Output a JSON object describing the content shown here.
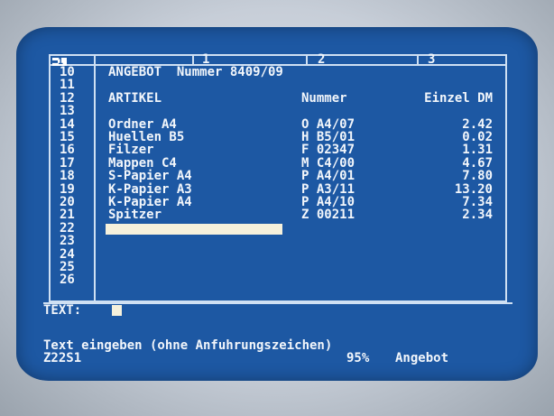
{
  "sheet": {
    "cell_ref_marker": "▬1",
    "columns": [
      "1",
      "2",
      "3"
    ],
    "rows": [
      {
        "num": "10",
        "text": "ANGEBOT  Nummer 8409/09",
        "code": "",
        "price": ""
      },
      {
        "num": "11",
        "text": "",
        "code": "",
        "price": ""
      },
      {
        "num": "12",
        "text": "ARTIKEL",
        "code": "Nummer",
        "price": "Einzel DM"
      },
      {
        "num": "13",
        "text": "",
        "code": "",
        "price": ""
      },
      {
        "num": "14",
        "text": "Ordner A4",
        "code": "O A4/07",
        "price": "2.42"
      },
      {
        "num": "15",
        "text": "Huellen B5",
        "code": "H B5/01",
        "price": "0.02"
      },
      {
        "num": "16",
        "text": "Filzer",
        "code": "F 02347",
        "price": "1.31"
      },
      {
        "num": "17",
        "text": "Mappen C4",
        "code": "M C4/00",
        "price": "4.67"
      },
      {
        "num": "18",
        "text": "S-Papier A4",
        "code": "P A4/01",
        "price": "7.80"
      },
      {
        "num": "19",
        "text": "K-Papier A3",
        "code": "P A3/11",
        "price": "13.20"
      },
      {
        "num": "20",
        "text": "K-Papier A4",
        "code": "P A4/10",
        "price": "7.34"
      },
      {
        "num": "21",
        "text": "Spitzer",
        "code": "Z 00211",
        "price": "2.34"
      },
      {
        "num": "22",
        "text": "",
        "code": "",
        "price": ""
      },
      {
        "num": "23",
        "text": "",
        "code": "",
        "price": ""
      },
      {
        "num": "24",
        "text": "",
        "code": "",
        "price": ""
      },
      {
        "num": "25",
        "text": "",
        "code": "",
        "price": ""
      },
      {
        "num": "26",
        "text": "",
        "code": "",
        "price": ""
      }
    ]
  },
  "input": {
    "label": "TEXT:"
  },
  "help_line": "Text eingeben (ohne Anfuhrungszeichen)",
  "status": {
    "cell": "Z22S1",
    "memory": "95%",
    "filename": "Angebot"
  },
  "colors": {
    "screen": "#1d58a3",
    "text": "#f2f6fb",
    "cursor": "#f6f1dc"
  }
}
